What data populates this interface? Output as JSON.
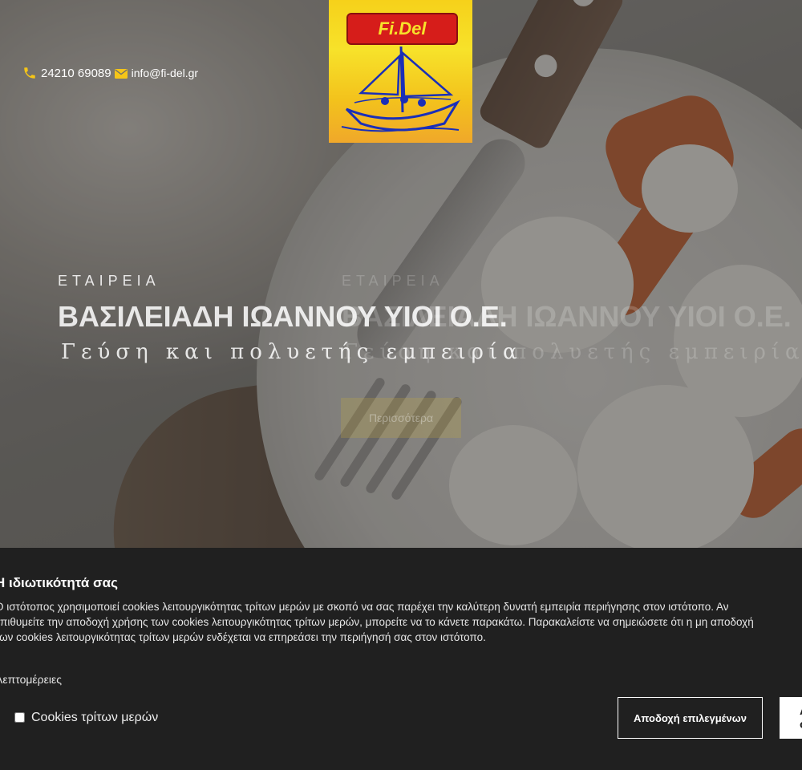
{
  "header": {
    "phone": "24210 69089",
    "email": "info@fi-del.gr",
    "icons": {
      "phone": "phone-icon",
      "email": "envelope-icon"
    },
    "accent_color": "#f5c518"
  },
  "logo": {
    "text": "Fi.Del"
  },
  "slides": [
    {
      "kicker": "ΕΤΑΙΡΕΙΑ",
      "headline": "ΒΑΣΙΛΕΙΑΔΗ ΙΩΑΝΝΟΥ ΥΙΟΙ Ο.Ε.",
      "tagline": "Γεύση και πολυετής εμπειρία"
    },
    {
      "kicker": "ΕΤΑΙΡΕΙΑ",
      "headline": "ΒΑΣΙΛΕΙΑΔΗ ΙΩΑΝΝΟΥ ΥΙΟΙ Ο.Ε.",
      "tagline": "Γεύση και πολυετής εμπειρία",
      "button_label": "Περισσότερα"
    }
  ],
  "cookie_banner": {
    "title": "Η ιδιωτικότητά σας",
    "text_lines": [
      "Ο ιστότοπος χρησιμοποιεί cookies λειτουργικότητας τρίτων μερών με σκοπό να σας παρέχει την καλύτερη δυνατή εμπειρία περιήγησης στον ιστότοπο. Αν",
      "επιθυμείτε την αποδοχή χρήσης των cookies λειτουργικότητας τρίτων μερών, μπορείτε να το κάνετε παρακάτω. Παρακαλείστε να σημειώσετε ότι η μη αποδοχή",
      "των cookies λειτουργικότητας τρίτων μερών ενδέχεται να επηρεάσει την περιήγησή σας στον ιστότοπο."
    ],
    "details_link": "Λεπτομέρειες",
    "checkbox_label": "Cookies τρίτων μερών",
    "checkbox_checked": false,
    "accept_selected_label": "Αποδοχή επιλεγμένων",
    "accept_all_label": "Αποδοχή όλων"
  }
}
